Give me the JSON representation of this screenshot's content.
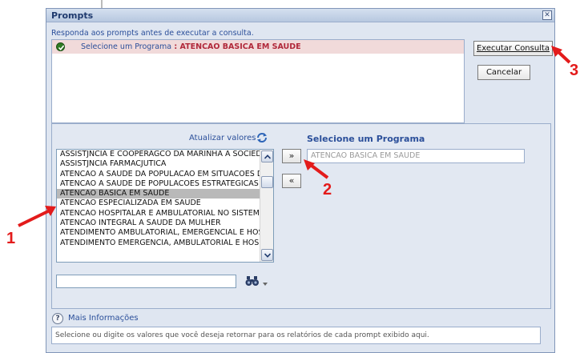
{
  "dialog": {
    "title": "Prompts",
    "close_glyph": "✕",
    "instruction": "Responda aos prompts antes de executar a consulta.",
    "prompts": [
      {
        "label": "Selecione um Programa",
        "separator": " : ",
        "value": "ATENCAO BASICA EM SAUDE",
        "status_icon": "check-icon"
      }
    ],
    "buttons": {
      "execute": "Executar Consulta",
      "cancel": "Cancelar"
    }
  },
  "panel": {
    "refresh_label": "Atualizar valores",
    "refresh_icon": "refresh-icon",
    "available_values": [
      "ASSISTJNCIA E COOPERAGCO DA MARINHA A SOCIEDADE",
      "ASSISTJNCIA FARMACJUTICA",
      "ATENCAO A SAUDE DA POPULACAO EM SITUACOES DE RISCO",
      "ATENCAO A SAUDE DE POPULACOES ESTRATEGICAS",
      "ATENCAO BASICA EM SAUDE",
      "ATENCAO ESPECIALIZADA EM SAUDE",
      "ATENCAO HOSPITALAR E AMBULATORIAL NO SISTEMA",
      "ATENCAO INTEGRAL A SAUDE DA MULHER",
      "ATENDIMENTO AMBULATORIAL, EMERGENCIAL E HOSPITALAR",
      "ATENDIMENTO EMERGENCIA, AMBULATORIAL E HOSPITALAR"
    ],
    "selected_index": 4,
    "add_label": "»",
    "remove_label": "«",
    "selected_title": "Selecione um Programa",
    "selected_value": "ATENCAO BASICA EM SAUDE",
    "search_value": "",
    "search_icon": "binoculars-icon"
  },
  "help": {
    "icon_glyph": "?",
    "label": "Mais Informações",
    "text": "Selecione ou digite os valores que você deseja retornar para os relatórios de cada prompt exibido aqui."
  },
  "annotations": {
    "one": "1",
    "two": "2",
    "three": "3",
    "color": "#e31b1b"
  }
}
